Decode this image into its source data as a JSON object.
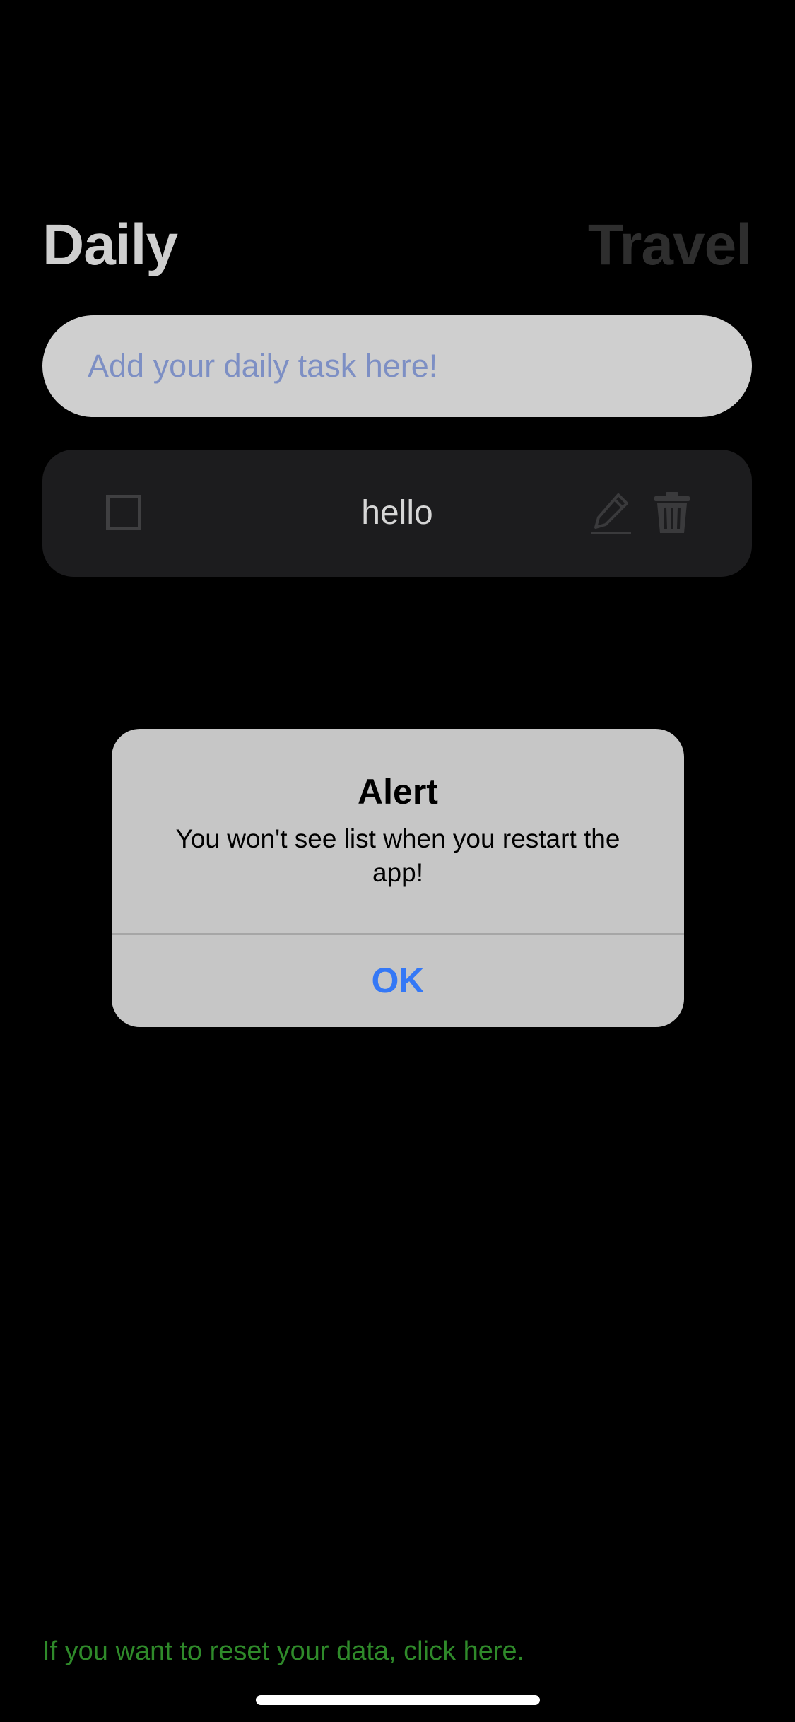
{
  "tabs": {
    "daily_label": "Daily",
    "travel_label": "Travel"
  },
  "task_input": {
    "placeholder": "Add your daily task here!",
    "value": ""
  },
  "tasks": [
    {
      "text": "hello",
      "checked": false,
      "edit_icon": "pencil-icon",
      "delete_icon": "trash-icon"
    }
  ],
  "alert": {
    "title": "Alert",
    "message": "You won't see list when you restart the app!",
    "ok_label": "OK"
  },
  "footer": {
    "reset_text": "If you want to reset your data, click here."
  },
  "colors": {
    "background": "#000000",
    "input_bg": "#cfcfcf",
    "placeholder": "#7d8fc4",
    "card_bg": "#1c1c1e",
    "alert_bg": "#c6c6c6",
    "alert_button": "#3478f6",
    "reset_link": "#2f8a2a"
  }
}
